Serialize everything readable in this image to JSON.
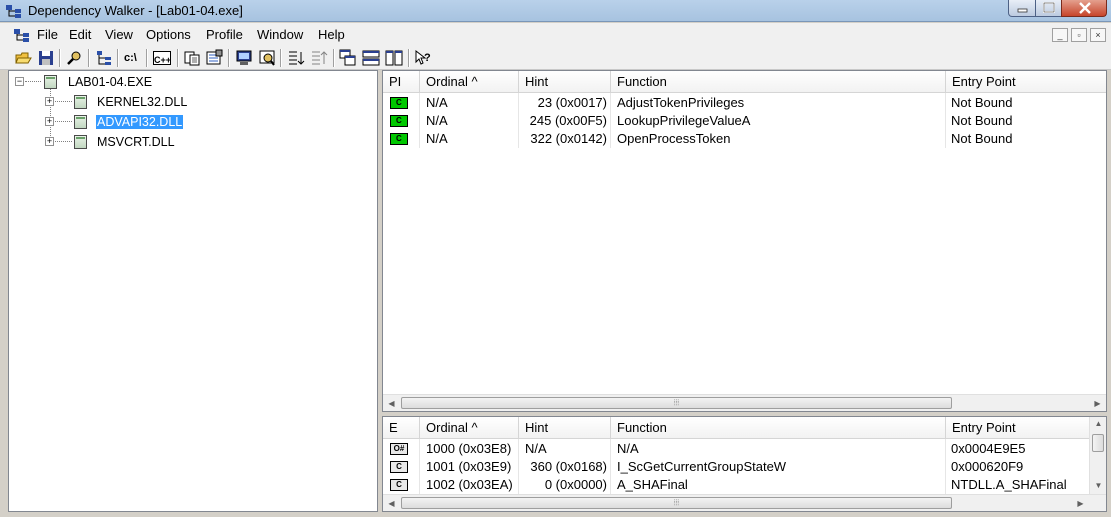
{
  "window": {
    "title": "Dependency Walker - [Lab01-04.exe]"
  },
  "menu": [
    "File",
    "Edit",
    "View",
    "Options",
    "Profile",
    "Window",
    "Help"
  ],
  "toolbar_icons": [
    "open-icon",
    "save-icon",
    "find-icon",
    "module-tree-icon",
    "full-paths-icon",
    "undecorate-cpp-icon",
    "copy-icon",
    "properties-icon",
    "view-module-icon",
    "highlight-icon",
    "collapse-icon",
    "expand-icon",
    "cascade-icon",
    "tile-horizontal-icon",
    "tile-vertical-icon",
    "context-help-icon"
  ],
  "tree": {
    "root": "LAB01-04.EXE",
    "children": [
      "KERNEL32.DLL",
      "ADVAPI32.DLL",
      "MSVCRT.DLL"
    ],
    "selected": "ADVAPI32.DLL"
  },
  "imports": {
    "columns": [
      "PI",
      "Ordinal ^",
      "Hint",
      "Function",
      "Entry Point"
    ],
    "rows": [
      {
        "ordinal": "N/A",
        "hint": "23 (0x0017)",
        "function": "AdjustTokenPrivileges",
        "entry": "Not Bound"
      },
      {
        "ordinal": "N/A",
        "hint": "245 (0x00F5)",
        "function": "LookupPrivilegeValueA",
        "entry": "Not Bound"
      },
      {
        "ordinal": "N/A",
        "hint": "322 (0x0142)",
        "function": "OpenProcessToken",
        "entry": "Not Bound"
      }
    ]
  },
  "exports": {
    "columns": [
      "E",
      "Ordinal ^",
      "Hint",
      "Function",
      "Entry Point"
    ],
    "rows": [
      {
        "icon": "O#",
        "ordinal": "1000 (0x03E8)",
        "hint": "N/A",
        "function": "N/A",
        "entry": "0x0004E9E5"
      },
      {
        "icon": "C",
        "ordinal": "1001 (0x03E9)",
        "hint": "360 (0x0168)",
        "function": "I_ScGetCurrentGroupStateW",
        "entry": "0x000620F9"
      },
      {
        "icon": "C",
        "ordinal": "1002 (0x03EA)",
        "hint": "0 (0x0000)",
        "function": "A_SHAFinal",
        "entry": "NTDLL.A_SHAFinal"
      }
    ]
  },
  "colors": {
    "selection": "#3399ff",
    "import_icon": "#00c800",
    "titlebar": "#b9d1ea"
  }
}
